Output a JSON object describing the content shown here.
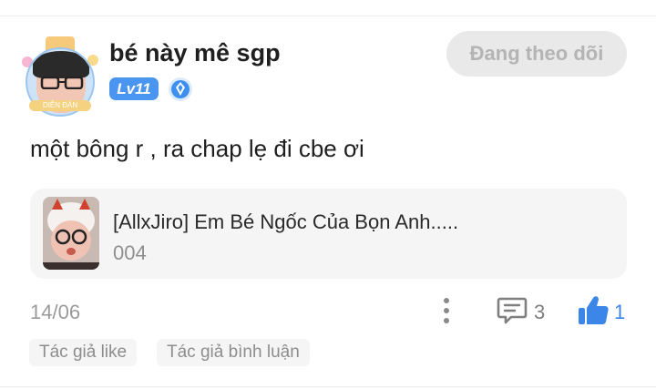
{
  "user": {
    "name": "bé này mê sgp",
    "level": "Lv11",
    "avatar_banner_text": "DIỄN ĐÀN TRUYỆN",
    "follow_label": "Đang theo dõi"
  },
  "comment": {
    "text": "một bông r , ra chap lẹ đi cbe ơi",
    "date": "14/06",
    "reply_count": "3",
    "like_count": "1"
  },
  "story": {
    "title": "[AllxJiro] Em Bé Ngốc Của Bọn Anh.....",
    "chapter": "004"
  },
  "tags": [
    "Tác giả like",
    "Tác giả bình luận"
  ],
  "icons": {
    "verify": "verified-badge-icon",
    "more": "more-vertical-icon",
    "comment": "comment-bubble-icon",
    "like": "thumbs-up-icon"
  },
  "colors": {
    "accent": "#3b86e8",
    "level_badge": "#4a95f0",
    "follow_button_bg": "#e9e9e9",
    "follow_button_text": "#b4b4b4"
  }
}
